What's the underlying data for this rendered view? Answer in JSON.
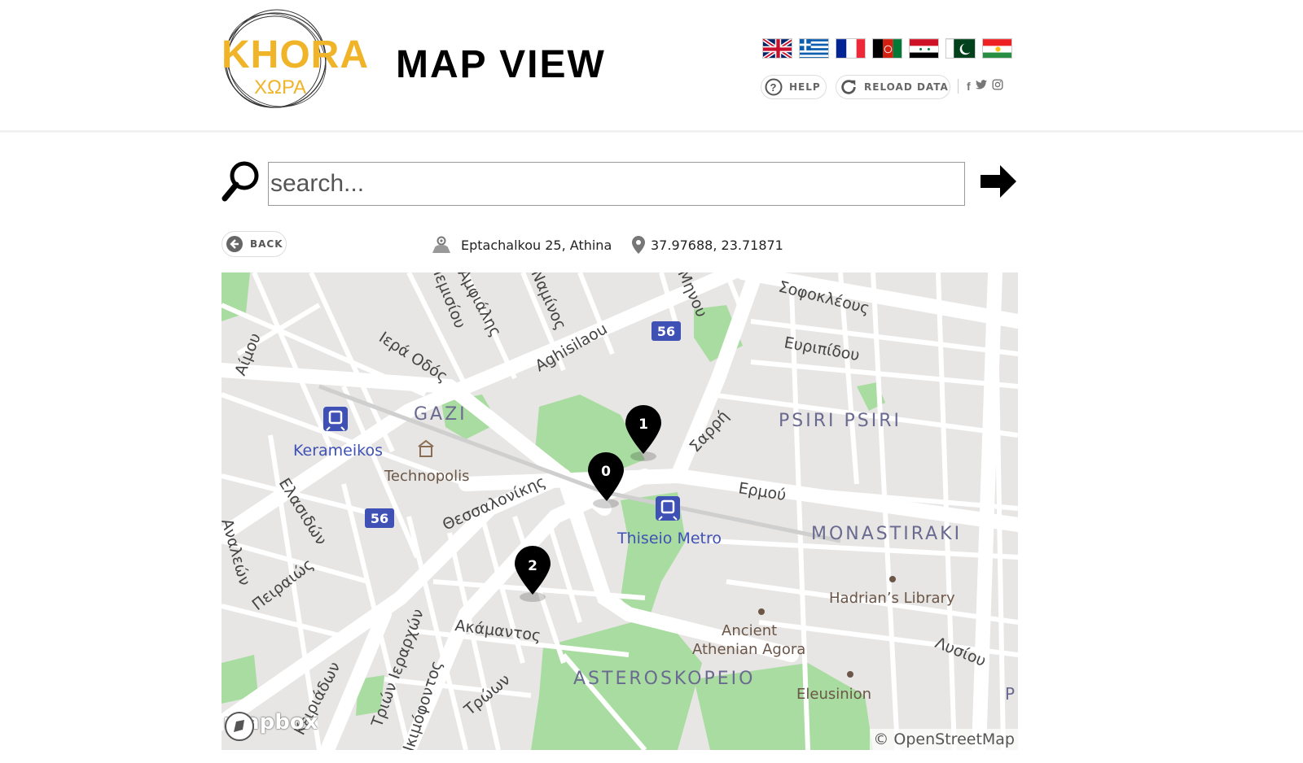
{
  "header": {
    "logo_main": "KHORA",
    "logo_sub": "ΧΩΡΑ",
    "title": "MAP VIEW",
    "flags": [
      "uk-flag",
      "greece-flag",
      "france-flag",
      "afghanistan-flag",
      "syria-flag",
      "pakistan-flag",
      "kurdistan-flag"
    ],
    "help_label": "HELP",
    "reload_label": "RELOAD DATA",
    "socials": [
      "f",
      "twitter-icon",
      "instagram-icon"
    ]
  },
  "search": {
    "placeholder": "search..."
  },
  "location": {
    "back_label": "BACK",
    "address": "Eptachalkou 25, Athina",
    "coordinates": "37.97688, 23.71871"
  },
  "map": {
    "markers": [
      "0",
      "1",
      "2"
    ],
    "street_labels": [
      "Σοφοκλέους",
      "Ευριπίδου",
      "Ιερά Οδός",
      "Aghisilaou",
      "Αίμου",
      "Σαρρή",
      "Ερμού",
      "Θεσσαλονίκης",
      "Ελασιδών",
      "Πειραιώς",
      "Ακάμαντος",
      "Τριών Ιεραρχών",
      "Κειριάδων",
      "Τρώων",
      "Λυσίου",
      "Αμφιάλης",
      "Ιεμισίου",
      "Ναμίνος",
      "Μηνου",
      "Αναλεών",
      "Ικιμόφοντος"
    ],
    "bus_badges": [
      "56",
      "56"
    ],
    "districts": [
      "GAZI",
      "PSIRI PSIRI",
      "MONASTIRAKI",
      "ASTEROSKOPEIO"
    ],
    "stations": [
      "Kerameikos",
      "Thiseio Metro"
    ],
    "pois": [
      "Technopolis",
      "Hadrian’s Library",
      "Ancient",
      "Athenian Agora",
      "Eleusinion"
    ],
    "edge_letter": "P",
    "attribution": "© OpenStreetMap",
    "provider_logo": "mapbox",
    "colors": {
      "land": "#e7e6e4",
      "road": "#ffffff",
      "park": "#a9dca0",
      "marker": "#000000",
      "bus": "#3f51b5",
      "district": "#6a6a90"
    }
  }
}
